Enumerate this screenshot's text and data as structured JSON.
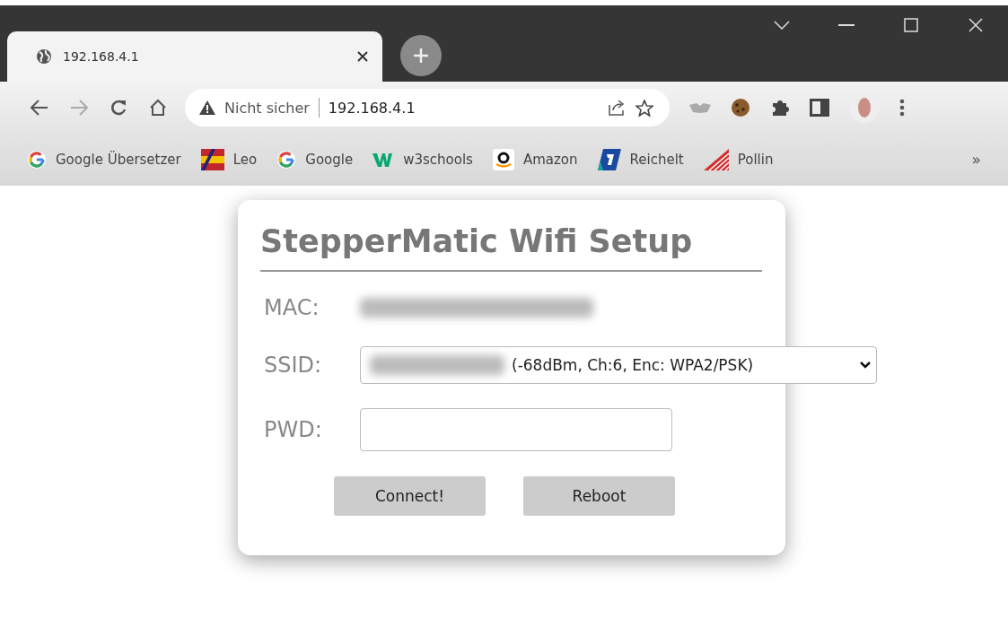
{
  "tab": {
    "title": "192.168.4.1",
    "selected": true
  },
  "address_bar": {
    "security": "Nicht sicher",
    "url": "192.168.4.1"
  },
  "bookmarks": [
    {
      "label": "Google Übersetzer",
      "kind": "google"
    },
    {
      "label": "Leo",
      "kind": "leo"
    },
    {
      "label": "Google",
      "kind": "google"
    },
    {
      "label": "w3schools",
      "kind": "w3"
    },
    {
      "label": "Amazon",
      "kind": "amazon"
    },
    {
      "label": "Reichelt",
      "kind": "reichelt"
    },
    {
      "label": "Pollin",
      "kind": "pollin"
    }
  ],
  "bookmarks_overflow": "»",
  "card": {
    "title": "StepperMatic Wifi Setup",
    "mac_label": "MAC:",
    "ssid_label": "SSID:",
    "ssid_option": "(-68dBm, Ch:6, Enc: WPA2/PSK)",
    "pwd_label": "PWD:",
    "buttons": [
      "Connect!",
      "Reboot"
    ]
  }
}
